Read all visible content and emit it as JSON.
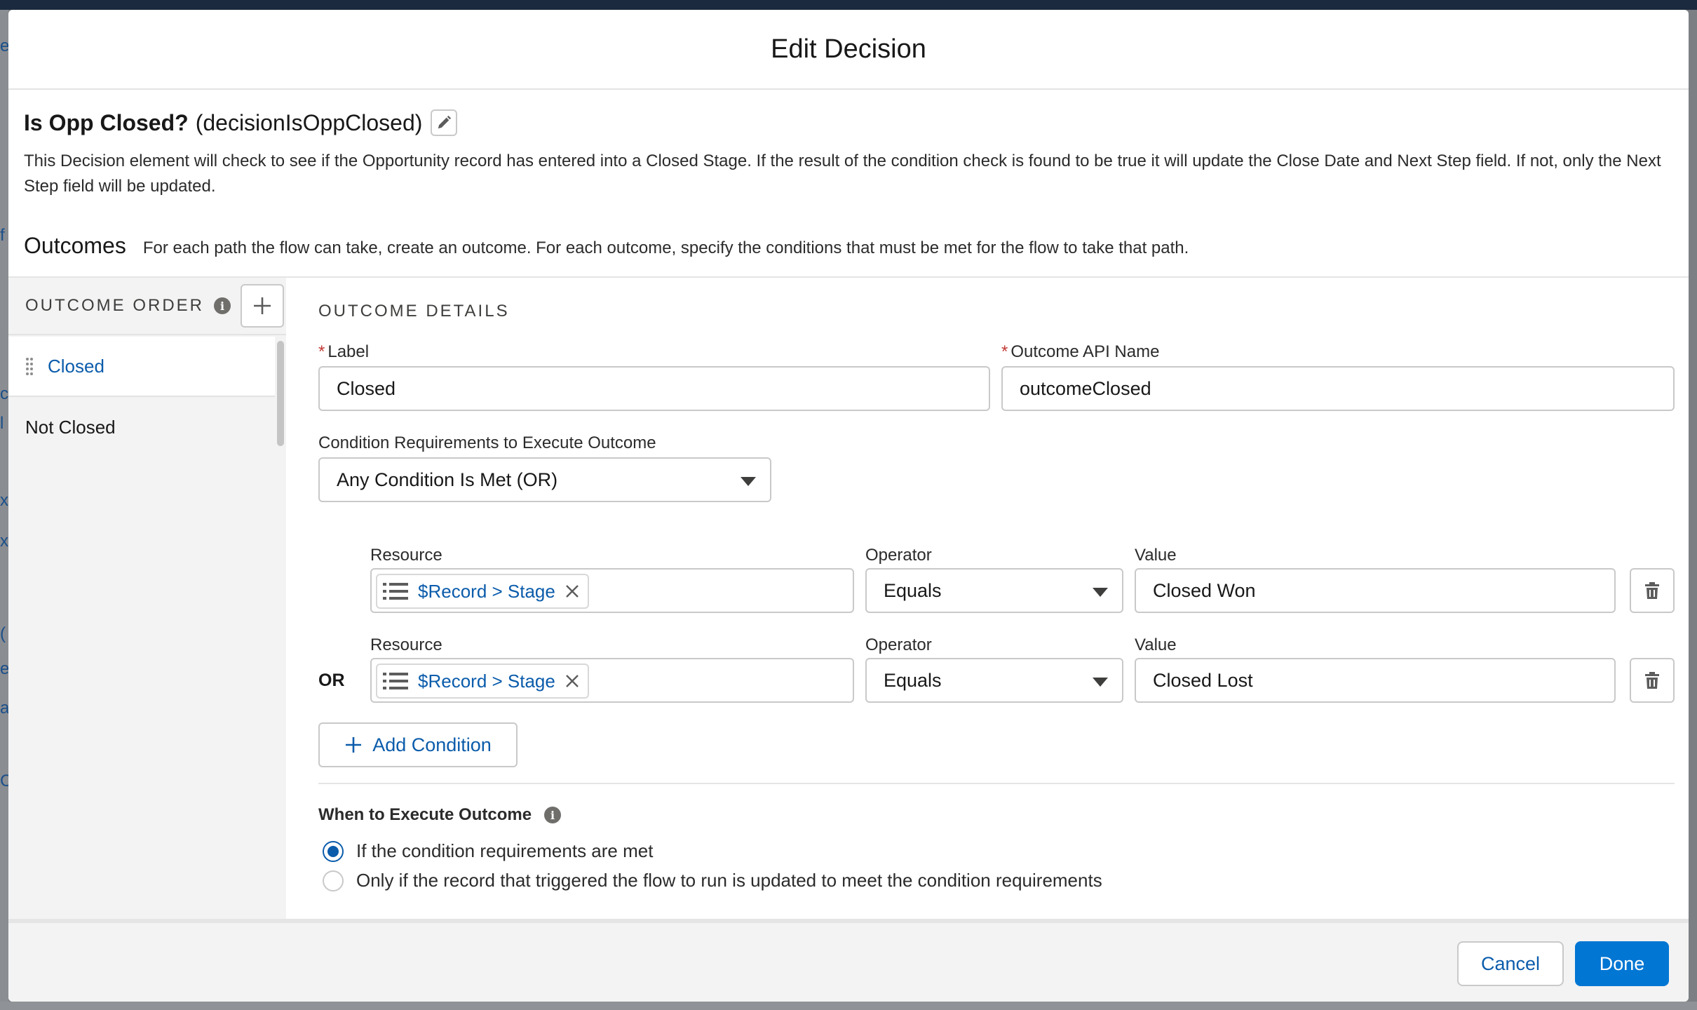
{
  "background": {
    "fragments": [
      "e",
      "f",
      "c",
      "l",
      "x",
      "x",
      "(",
      "e",
      "a",
      "C"
    ]
  },
  "modal": {
    "title": "Edit Decision"
  },
  "element": {
    "label": "Is Opp Closed?",
    "api_name": "(decisionIsOppClosed)",
    "description": "This Decision element will check to see if the Opportunity record has entered into a Closed Stage. If the result of the condition check is found to be true it will update the Close Date and Next Step field. If not, only the Next Step field will be updated."
  },
  "outcomes": {
    "title": "Outcomes",
    "help": "For each path the flow can take, create an outcome. For each outcome, specify the conditions that must be met for the flow to take that path.",
    "order_title": "OUTCOME ORDER",
    "items": [
      {
        "label": "Closed",
        "active": true
      },
      {
        "label": "Not Closed",
        "active": false
      }
    ]
  },
  "details": {
    "section_title": "OUTCOME DETAILS",
    "label_label": "Label",
    "label_value": "Closed",
    "api_label": "Outcome API Name",
    "api_value": "outcomeClosed",
    "requirements_label": "Condition Requirements to Execute Outcome",
    "requirements_value": "Any Condition Is Met (OR)",
    "conditions": [
      {
        "logic": "",
        "resource_label": "Resource",
        "resource_value": "$Record > Stage",
        "operator_label": "Operator",
        "operator_value": "Equals",
        "value_label": "Value",
        "value": "Closed Won"
      },
      {
        "logic": "OR",
        "resource_label": "Resource",
        "resource_value": "$Record > Stage",
        "operator_label": "Operator",
        "operator_value": "Equals",
        "value_label": "Value",
        "value": "Closed Lost"
      }
    ],
    "add_condition_label": "Add Condition",
    "when_title": "When to Execute Outcome",
    "when_options": [
      {
        "label": "If the condition requirements are met",
        "checked": true
      },
      {
        "label": "Only if the record that triggered the flow to run is updated to meet the condition requirements",
        "checked": false
      }
    ]
  },
  "footer": {
    "cancel_label": "Cancel",
    "done_label": "Done"
  },
  "colors": {
    "brand": "#0176d3",
    "link": "#0b5cab",
    "required": "#c23934"
  }
}
